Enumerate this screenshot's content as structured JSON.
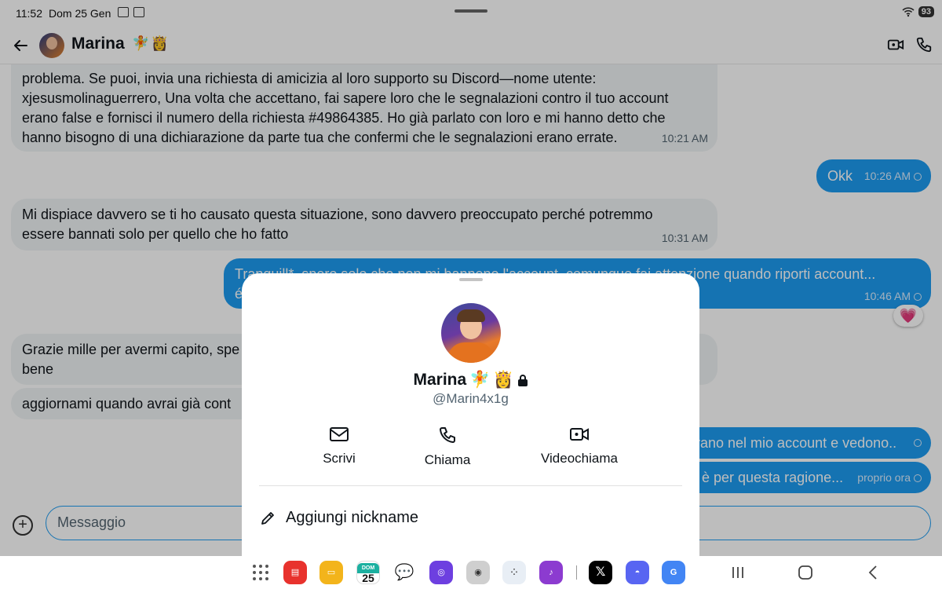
{
  "status": {
    "time": "11:52",
    "date": "Dom 25 Gen",
    "battery": "93"
  },
  "header": {
    "name": "Marina",
    "emoji": [
      "🧚",
      "👸"
    ]
  },
  "messages": [
    {
      "dir": "in",
      "lines": [
        "problema. Se puoi, invia una richiesta di amicizia al loro supporto su Discord—nome utente:",
        "xjesusmolinaguerrero, Una volta che accettano, fai sapere loro che le segnalazioni contro il tuo account",
        "erano false e fornisci il numero della richiesta #49864385. Ho già parlato con loro e mi hanno detto che",
        "hanno bisogno di una dichiarazione da parte tua che confermi che le segnalazioni erano errate."
      ],
      "time": "10:21 AM"
    },
    {
      "dir": "out",
      "text": "Okk",
      "time": "10:26 AM"
    },
    {
      "dir": "in",
      "lines": [
        "Mi dispiace davvero se ti ho causato questa situazione, sono davvero preoccupato perché potremmo",
        "essere bannati solo per quello che ho fatto"
      ],
      "time": "10:31 AM"
    },
    {
      "dir": "out",
      "lines": [
        "Tranquill*, spero solo che non mi banneno l'account, comunque fai attenzione quando riporti account...",
        "é"
      ],
      "time": "10:46 AM",
      "reaction": "💗"
    },
    {
      "dir": "in",
      "lines": [
        "Grazie mille per avermi capito, spe",
        "bene"
      ]
    },
    {
      "dir": "in",
      "text": "aggiornami quando avrai già cont"
    },
    {
      "dir": "out",
      "text": "rano nel mio account e vedono.."
    },
    {
      "dir": "out",
      "text": "è per questa ragione...",
      "time": "proprio ora"
    }
  ],
  "composer": {
    "placeholder": "Messaggio"
  },
  "sheet": {
    "name": "Marina",
    "emoji": [
      "🧚",
      "👸"
    ],
    "handle": "@Marin4x1g",
    "actions": {
      "message": "Scrivi",
      "call": "Chiama",
      "video": "Videochiama"
    },
    "nickname": "Aggiungi nickname"
  },
  "dock": {
    "calendar_day": "25",
    "calendar_label": "DOM"
  }
}
